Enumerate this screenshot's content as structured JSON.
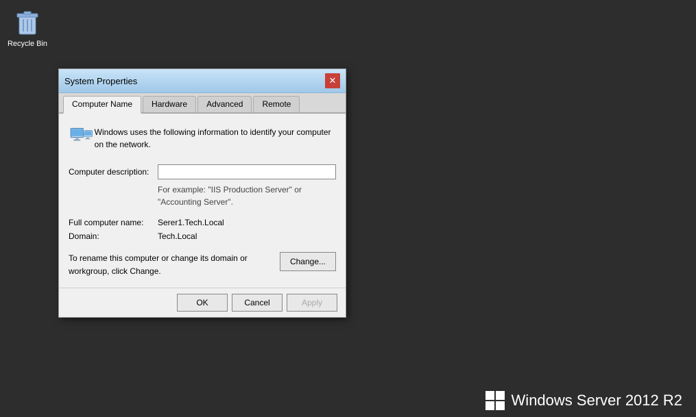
{
  "desktop": {
    "recycle_bin_label": "Recycle Bin"
  },
  "branding": {
    "text": "Windows Server 2012 R2"
  },
  "dialog": {
    "title": "System Properties",
    "tabs": [
      {
        "label": "Computer Name",
        "active": true
      },
      {
        "label": "Hardware",
        "active": false
      },
      {
        "label": "Advanced",
        "active": false
      },
      {
        "label": "Remote",
        "active": false
      }
    ],
    "info_text": "Windows uses the following information to identify your computer on the network.",
    "form": {
      "description_label": "Computer description:",
      "description_placeholder": "",
      "hint_line1": "For example: \"IIS Production Server\" or",
      "hint_line2": "\"Accounting Server\".",
      "full_computer_name_label": "Full computer name:",
      "full_computer_name_value": "Serer1.Tech.Local",
      "domain_label": "Domain:",
      "domain_value": "Tech.Local"
    },
    "rename": {
      "text": "To rename this computer or change its domain or workgroup, click Change.",
      "change_button": "Change..."
    },
    "footer": {
      "ok_label": "OK",
      "cancel_label": "Cancel",
      "apply_label": "Apply"
    }
  }
}
